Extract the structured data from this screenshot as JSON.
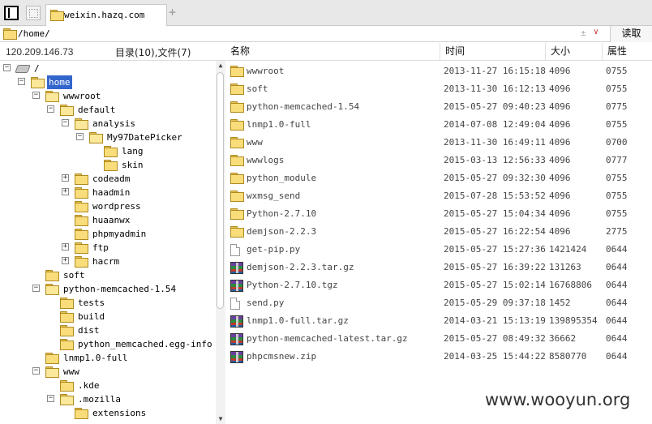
{
  "tabbar": {
    "tab_title": "weixin.hazq.com",
    "add_tab": "+"
  },
  "pathbar": {
    "path": "/home/",
    "plus": "±",
    "dropdown": "∨",
    "read_label": "读取"
  },
  "info": {
    "ip": "120.209.146.73",
    "summary": "目录(10),文件(7)"
  },
  "tree": [
    {
      "label": "/",
      "depth": 0,
      "exp": "−",
      "icon": "drive-icon"
    },
    {
      "label": "home",
      "depth": 1,
      "exp": "−",
      "icon": "folder-open-icon",
      "selected": true
    },
    {
      "label": "wwwroot",
      "depth": 2,
      "exp": "−",
      "icon": "folder-open-icon"
    },
    {
      "label": "default",
      "depth": 3,
      "exp": "−",
      "icon": "folder-open-icon"
    },
    {
      "label": "analysis",
      "depth": 4,
      "exp": "−",
      "icon": "folder-open-icon"
    },
    {
      "label": "My97DatePicker",
      "depth": 5,
      "exp": "−",
      "icon": "folder-open-icon"
    },
    {
      "label": "lang",
      "depth": 6,
      "exp": "",
      "icon": "folder-icon"
    },
    {
      "label": "skin",
      "depth": 6,
      "exp": "",
      "icon": "folder-icon"
    },
    {
      "label": "codeadm",
      "depth": 4,
      "exp": "+",
      "icon": "folder-icon"
    },
    {
      "label": "haadmin",
      "depth": 4,
      "exp": "+",
      "icon": "folder-icon"
    },
    {
      "label": "wordpress",
      "depth": 4,
      "exp": "",
      "icon": "folder-icon"
    },
    {
      "label": "huaanwx",
      "depth": 4,
      "exp": "",
      "icon": "folder-icon"
    },
    {
      "label": "phpmyadmin",
      "depth": 4,
      "exp": "",
      "icon": "folder-icon"
    },
    {
      "label": "ftp",
      "depth": 4,
      "exp": "+",
      "icon": "folder-icon"
    },
    {
      "label": "hacrm",
      "depth": 4,
      "exp": "+",
      "icon": "folder-icon"
    },
    {
      "label": "soft",
      "depth": 2,
      "exp": "",
      "icon": "folder-icon"
    },
    {
      "label": "python-memcached-1.54",
      "depth": 2,
      "exp": "−",
      "icon": "folder-open-icon"
    },
    {
      "label": "tests",
      "depth": 3,
      "exp": "",
      "icon": "folder-icon"
    },
    {
      "label": "build",
      "depth": 3,
      "exp": "",
      "icon": "folder-icon"
    },
    {
      "label": "dist",
      "depth": 3,
      "exp": "",
      "icon": "folder-icon"
    },
    {
      "label": "python_memcached.egg-info",
      "depth": 3,
      "exp": "",
      "icon": "folder-icon"
    },
    {
      "label": "lnmp1.0-full",
      "depth": 2,
      "exp": "",
      "icon": "folder-icon"
    },
    {
      "label": "www",
      "depth": 2,
      "exp": "−",
      "icon": "folder-open-icon"
    },
    {
      "label": ".kde",
      "depth": 3,
      "exp": "",
      "icon": "folder-icon"
    },
    {
      "label": ".mozilla",
      "depth": 3,
      "exp": "−",
      "icon": "folder-open-icon"
    },
    {
      "label": "extensions",
      "depth": 4,
      "exp": "",
      "icon": "folder-icon"
    }
  ],
  "columns": {
    "name": "名称",
    "time": "时间",
    "size": "大小",
    "mode": "属性"
  },
  "files": [
    {
      "name": "wwwroot",
      "time": "2013-11-27 16:15:18",
      "size": "4096",
      "mode": "0755",
      "icon": "folder-icon"
    },
    {
      "name": "soft",
      "time": "2013-11-30 16:12:13",
      "size": "4096",
      "mode": "0755",
      "icon": "folder-icon"
    },
    {
      "name": "python-memcached-1.54",
      "time": "2015-05-27 09:40:23",
      "size": "4096",
      "mode": "0775",
      "icon": "folder-icon"
    },
    {
      "name": "lnmp1.0-full",
      "time": "2014-07-08 12:49:04",
      "size": "4096",
      "mode": "0755",
      "icon": "folder-icon"
    },
    {
      "name": "www",
      "time": "2013-11-30 16:49:11",
      "size": "4096",
      "mode": "0700",
      "icon": "folder-icon"
    },
    {
      "name": "wwwlogs",
      "time": "2015-03-13 12:56:33",
      "size": "4096",
      "mode": "0777",
      "icon": "folder-icon"
    },
    {
      "name": "python_module",
      "time": "2015-05-27 09:32:30",
      "size": "4096",
      "mode": "0755",
      "icon": "folder-icon"
    },
    {
      "name": "wxmsg_send",
      "time": "2015-07-28 15:53:52",
      "size": "4096",
      "mode": "0755",
      "icon": "folder-icon"
    },
    {
      "name": "Python-2.7.10",
      "time": "2015-05-27 15:04:34",
      "size": "4096",
      "mode": "0755",
      "icon": "folder-icon"
    },
    {
      "name": "demjson-2.2.3",
      "time": "2015-05-27 16:22:54",
      "size": "4096",
      "mode": "2775",
      "icon": "folder-icon"
    },
    {
      "name": "get-pip.py",
      "time": "2015-05-27 15:27:36",
      "size": "1421424",
      "mode": "0644",
      "icon": "file-icon"
    },
    {
      "name": "demjson-2.2.3.tar.gz",
      "time": "2015-05-27 16:39:22",
      "size": "131263",
      "mode": "0644",
      "icon": "archive-icon"
    },
    {
      "name": "Python-2.7.10.tgz",
      "time": "2015-05-27 15:02:14",
      "size": "16768806",
      "mode": "0644",
      "icon": "archive-icon"
    },
    {
      "name": "send.py",
      "time": "2015-05-29 09:37:18",
      "size": "1452",
      "mode": "0644",
      "icon": "file-icon"
    },
    {
      "name": "lnmp1.0-full.tar.gz",
      "time": "2014-03-21 15:13:19",
      "size": "139895354",
      "mode": "0644",
      "icon": "archive-icon"
    },
    {
      "name": "python-memcached-latest.tar.gz",
      "time": "2015-05-27 08:49:32",
      "size": "36662",
      "mode": "0644",
      "icon": "archive-icon"
    },
    {
      "name": "phpcmsnew.zip",
      "time": "2014-03-25 15:44:22",
      "size": "8580770",
      "mode": "0644",
      "icon": "archive-icon"
    }
  ],
  "watermark": "www.wooyun.org"
}
